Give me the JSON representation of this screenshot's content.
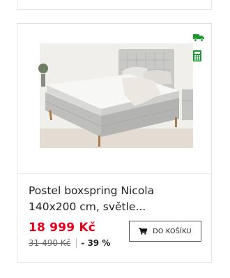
{
  "product": {
    "title": "Postel boxspring Nicola 140x200 cm, světle...",
    "price": "18 999 Kč",
    "old_price": "31 490 Kč",
    "discount": "- 39 %",
    "image_alt": "Postel boxspring Nicola"
  },
  "actions": {
    "add_to_cart_label": "DO KOŠÍKU"
  },
  "icons": {
    "delivery": "delivery-truck-icon",
    "calculator": "installment-calculator-icon",
    "cart": "shopping-cart-icon"
  },
  "colors": {
    "price": "#e3001b",
    "badge_green": "#1a9a2e",
    "border": "#e3e3e3"
  }
}
